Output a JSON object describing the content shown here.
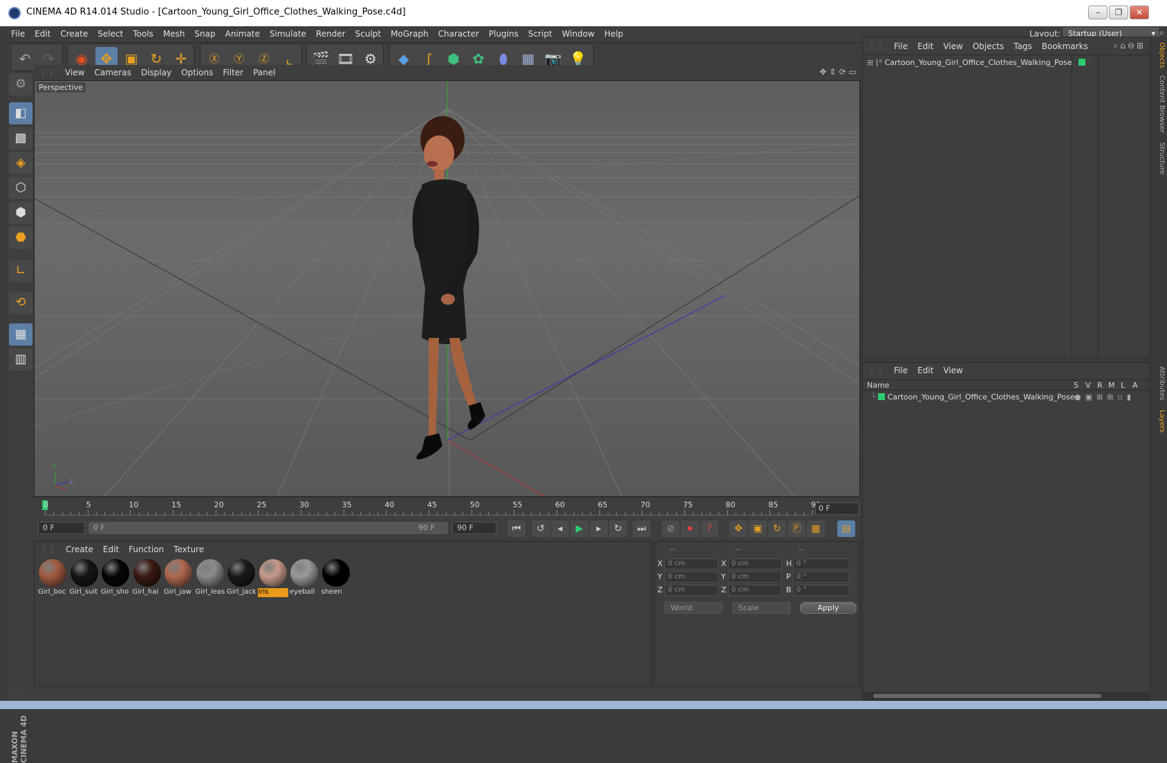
{
  "window": {
    "title": "CINEMA 4D R14.014 Studio - [Cartoon_Young_Girl_Office_Clothes_Walking_Pose.c4d]",
    "buttons": [
      "–",
      "❐",
      "✕"
    ]
  },
  "menubar": {
    "items": [
      "File",
      "Edit",
      "Create",
      "Select",
      "Tools",
      "Mesh",
      "Snap",
      "Animate",
      "Simulate",
      "Render",
      "Sculpt",
      "MoGraph",
      "Character",
      "Plugins",
      "Script",
      "Window",
      "Help"
    ],
    "layout_label": "Layout:",
    "layout_value": "Startup (User)"
  },
  "viewport": {
    "menu": [
      "View",
      "Cameras",
      "Display",
      "Options",
      "Filter",
      "Panel"
    ],
    "label": "Perspective",
    "axis_labels": {
      "y": "Y",
      "z": "Z"
    }
  },
  "timeline": {
    "ticks": [
      "0",
      "5",
      "10",
      "15",
      "20",
      "25",
      "30",
      "35",
      "40",
      "45",
      "50",
      "55",
      "60",
      "65",
      "70",
      "75",
      "80",
      "85",
      "90"
    ],
    "current_frame": "0 F"
  },
  "transport": {
    "start_field": "0 F",
    "range_start": "0 F",
    "range_end": "90 F",
    "end_field": "90 F"
  },
  "materials": {
    "menu": [
      "Create",
      "Edit",
      "Function",
      "Texture"
    ],
    "items": [
      {
        "name": "Girl_boc",
        "color": "#a05a40"
      },
      {
        "name": "Girl_suit",
        "color": "#151515"
      },
      {
        "name": "Girl_sho",
        "color": "#050505"
      },
      {
        "name": "Girl_hai",
        "color": "#3a1a12"
      },
      {
        "name": "Girl_jaw",
        "color": "#b06850"
      },
      {
        "name": "Girl_leas",
        "color": "#8a8a8a"
      },
      {
        "name": "Girl_jack",
        "color": "#1a1a1a"
      },
      {
        "name": "iris",
        "color": "#c89a8a"
      },
      {
        "name": "eyeball",
        "color": "#9a9a9a"
      },
      {
        "name": "sheen",
        "color": "#000000"
      }
    ],
    "selected_index": 7
  },
  "coordinates": {
    "headers": [
      "--",
      "--",
      "--"
    ],
    "rows": [
      {
        "l1": "X",
        "v1": "0 cm",
        "l2": "X",
        "v2": "0 cm",
        "l3": "H",
        "v3": "0 °"
      },
      {
        "l1": "Y",
        "v1": "0 cm",
        "l2": "Y",
        "v2": "0 cm",
        "l3": "P",
        "v3": "0 °"
      },
      {
        "l1": "Z",
        "v1": "0 cm",
        "l2": "Z",
        "v2": "0 cm",
        "l3": "B",
        "v3": "0 °"
      }
    ],
    "space_dropdown": "World",
    "mode_dropdown": "Scale",
    "apply_label": "Apply"
  },
  "objects": {
    "menu": [
      "File",
      "Edit",
      "View",
      "Objects",
      "Tags",
      "Bookmarks"
    ],
    "object_name": "Cartoon_Young_Girl_Office_Clothes_Walking_Pose"
  },
  "layers": {
    "menu": [
      "File",
      "Edit",
      "View"
    ],
    "columns": [
      "Name",
      "S",
      "V",
      "R",
      "M",
      "L",
      "A"
    ],
    "layer_name": "Cartoon_Young_Girl_Office_Clothes_Walking_Pose"
  },
  "right_tabs": [
    "Objects",
    "Content Browser",
    "Structure",
    "Attributes",
    "Layers"
  ],
  "branding": "MAXON CINEMA 4D",
  "colors": {
    "accent": "#e8a020",
    "selection": "#5c7fa6",
    "layer": "#2ecc71"
  }
}
